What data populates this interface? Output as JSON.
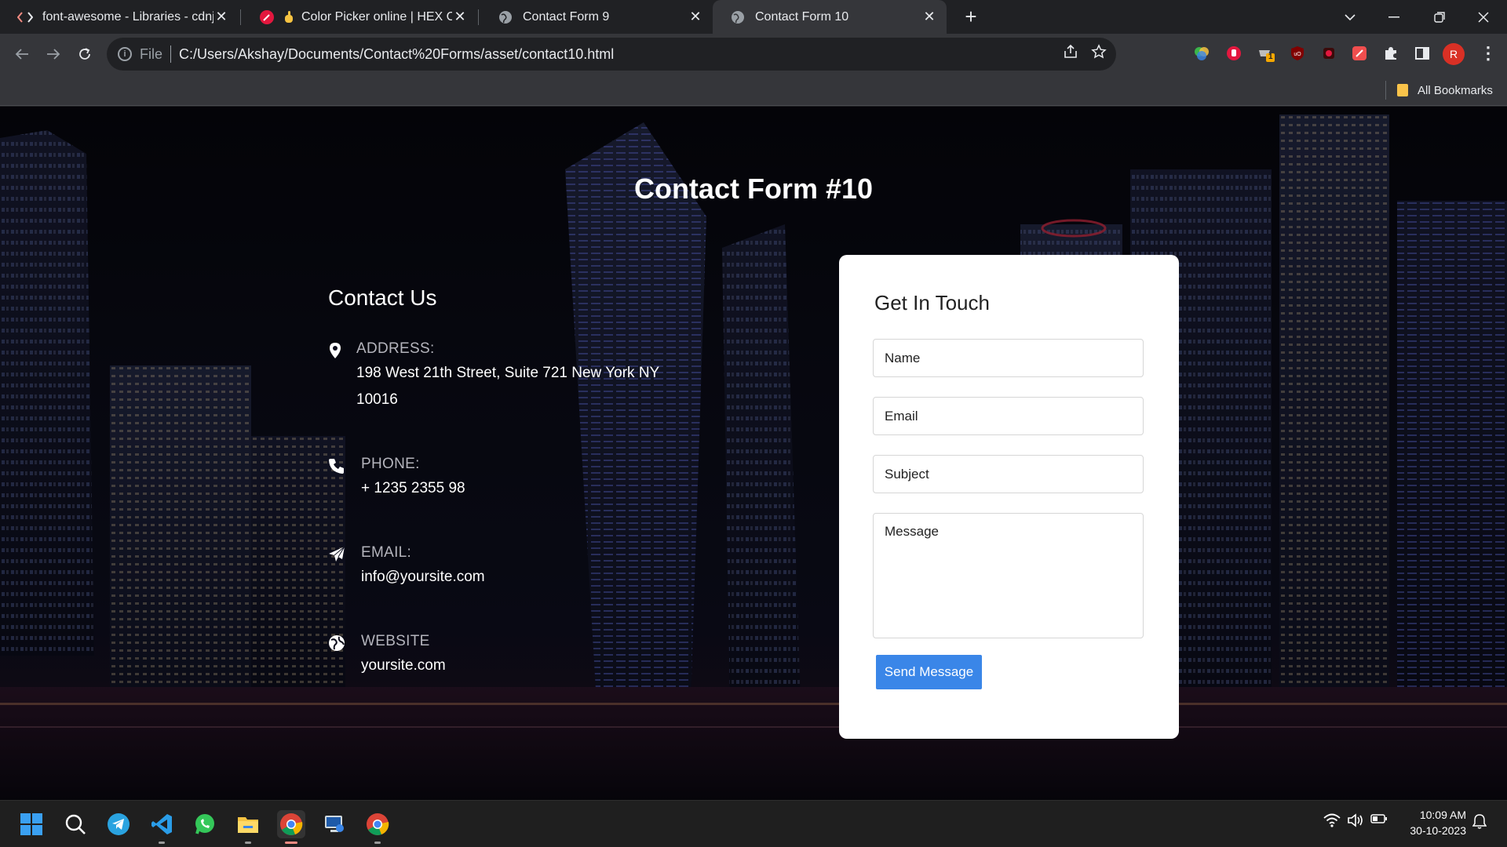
{
  "browser": {
    "tabs": [
      {
        "title": "font-awesome - Libraries - cdnjs",
        "active": false
      },
      {
        "title": "Color Picker online | HEX Color",
        "active": false
      },
      {
        "title": "Contact Form 9",
        "active": false
      },
      {
        "title": "Contact Form 10",
        "active": true
      }
    ],
    "address": {
      "scheme": "File",
      "url": "C:/Users/Akshay/Documents/Contact%20Forms/asset/contact10.html"
    },
    "profile_initial": "R",
    "bookmarks": {
      "all_label": "All Bookmarks"
    },
    "extension_badge": "1"
  },
  "page": {
    "title": "Contact Form #10",
    "contact": {
      "heading": "Contact Us",
      "address_label": "ADDRESS:",
      "address_line1": "198 West 21th Street, Suite 721 New York NY",
      "address_line2": "10016",
      "phone_label": "PHONE:",
      "phone_value": "+ 1235 2355 98",
      "email_label": "EMAIL:",
      "email_value": "info@yoursite.com",
      "website_label": "WEBSITE",
      "website_value": "yoursite.com"
    },
    "form": {
      "heading": "Get In Touch",
      "name_placeholder": "Name",
      "email_placeholder": "Email",
      "subject_placeholder": "Subject",
      "message_placeholder": "Message",
      "submit_label": "Send Message"
    }
  },
  "taskbar": {
    "time": "10:09 AM",
    "date": "30-10-2023"
  },
  "colors": {
    "accent_button": "#3a86e8",
    "card_bg": "#ffffff",
    "browser_dark": "#202124",
    "profile": "#d93025"
  }
}
